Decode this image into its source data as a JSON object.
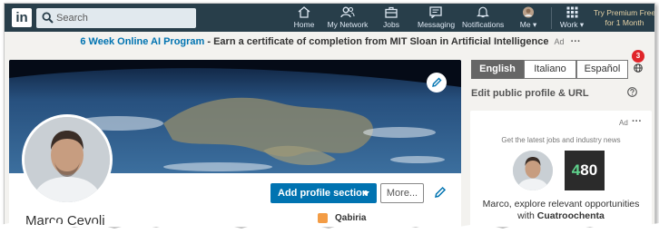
{
  "nav": {
    "logo_text": "in",
    "search_placeholder": "Search",
    "items": [
      {
        "label": "Home",
        "icon": "home-icon"
      },
      {
        "label": "My Network",
        "icon": "network-icon"
      },
      {
        "label": "Jobs",
        "icon": "briefcase-icon"
      },
      {
        "label": "Messaging",
        "icon": "messaging-icon"
      },
      {
        "label": "Notifications",
        "icon": "bell-icon"
      },
      {
        "label": "Me",
        "icon": "profile-avatar"
      },
      {
        "label": "Work",
        "icon": "grid-icon"
      }
    ],
    "premium_line1": "Try Premium Free",
    "premium_line2": "for 1 Month"
  },
  "banner": {
    "link_text": "6 Week Online AI Program",
    "separator": " - ",
    "rest_text": "Earn a certificate of completion from MIT Sloan in Artificial Intelligence",
    "ad_label": "Ad",
    "dots": "···"
  },
  "profile": {
    "name": "Marco Cevoli",
    "add_section_label": "Add profile section",
    "more_label": "More...",
    "company": "Qabiria"
  },
  "rail": {
    "languages": [
      "English",
      "Italiano",
      "Español"
    ],
    "active_language": "English",
    "notification_count": "3",
    "edit_public_label": "Edit public profile & URL"
  },
  "ad_card": {
    "ad_label": "Ad",
    "dots": "···",
    "tagline": "Get the latest jobs and industry news",
    "brand_text": "480",
    "message_line1": "Marco, explore relevant opportunities",
    "message_prefix": "with ",
    "message_company": "Cuatroochenta"
  },
  "colors": {
    "nav_bg": "#283e4a",
    "accent": "#0073b1",
    "page_bg": "#f3f2ef",
    "badge_red": "#e0252a"
  }
}
